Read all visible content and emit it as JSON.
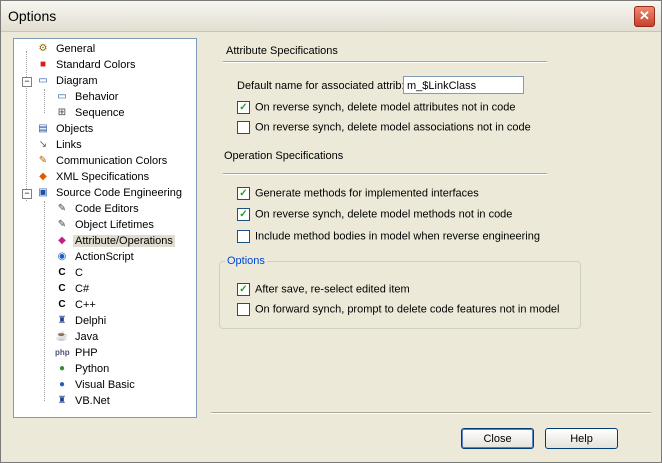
{
  "window": {
    "title": "Options",
    "close_glyph": "✕"
  },
  "tree": {
    "items": [
      {
        "label": "General",
        "icon": "general-icon"
      },
      {
        "label": "Standard Colors",
        "icon": "colors-icon"
      },
      {
        "label": "Diagram",
        "icon": "diagram-icon",
        "expanded": true
      },
      {
        "label": "Behavior",
        "icon": "behavior-icon"
      },
      {
        "label": "Sequence",
        "icon": "sequence-icon"
      },
      {
        "label": "Objects",
        "icon": "objects-icon"
      },
      {
        "label": "Links",
        "icon": "links-icon"
      },
      {
        "label": "Communication Colors",
        "icon": "comm-colors-icon"
      },
      {
        "label": "XML Specifications",
        "icon": "xml-icon"
      },
      {
        "label": "Source Code Engineering",
        "icon": "source-icon",
        "expanded": true
      },
      {
        "label": "Code Editors",
        "icon": "code-editor-icon"
      },
      {
        "label": "Object Lifetimes",
        "icon": "lifetime-icon"
      },
      {
        "label": "Attribute/Operations",
        "icon": "attr-ops-icon",
        "selected": true
      },
      {
        "label": "ActionScript",
        "icon": "actionscript-icon"
      },
      {
        "label": "C",
        "icon": "c-icon"
      },
      {
        "label": "C#",
        "icon": "csharp-icon"
      },
      {
        "label": "C++",
        "icon": "cpp-icon"
      },
      {
        "label": "Delphi",
        "icon": "delphi-icon"
      },
      {
        "label": "Java",
        "icon": "java-icon"
      },
      {
        "label": "PHP",
        "icon": "php-icon"
      },
      {
        "label": "Python",
        "icon": "python-icon"
      },
      {
        "label": "Visual Basic",
        "icon": "vb-icon"
      },
      {
        "label": "VB.Net",
        "icon": "vbnet-icon"
      }
    ],
    "expander_glyph": "−"
  },
  "attribute_section": {
    "title": "Attribute Specifications",
    "default_name_label": "Default name for associated attrib:",
    "default_name_value": "m_$LinkClass",
    "checkboxes": [
      {
        "label": "On reverse synch, delete model attributes not in code",
        "checked": true
      },
      {
        "label": "On reverse synch, delete model associations not in code",
        "checked": false
      }
    ]
  },
  "operation_section": {
    "title": "Operation Specifications",
    "checkboxes": [
      {
        "label": "Generate methods for implemented interfaces",
        "checked": true
      },
      {
        "label": "On reverse synch, delete model methods not in code",
        "checked": true
      },
      {
        "label": "Include method bodies in model when reverse engineering",
        "checked": false
      }
    ]
  },
  "options_group": {
    "title": "Options",
    "checkboxes": [
      {
        "label": "After save, re-select edited item",
        "checked": true
      },
      {
        "label": "On forward synch, prompt to delete code features not in model",
        "checked": false
      }
    ]
  },
  "check_glyph": "✓",
  "buttons": {
    "close": "Close",
    "help": "Help"
  },
  "colors": {
    "group_title": "#0046d5",
    "check": "#21a121"
  }
}
